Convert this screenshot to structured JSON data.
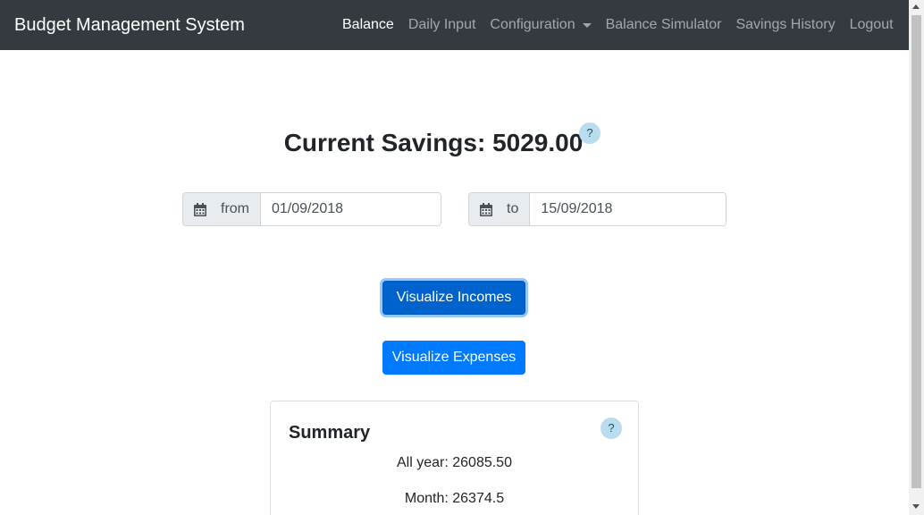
{
  "navbar": {
    "brand": "Budget Management System",
    "links": [
      {
        "label": "Balance",
        "active": true
      },
      {
        "label": "Daily Input",
        "active": false
      },
      {
        "label": "Configuration",
        "active": false
      },
      {
        "label": "Balance Simulator",
        "active": false
      },
      {
        "label": "Savings History",
        "active": false
      },
      {
        "label": "Logout",
        "active": false
      }
    ]
  },
  "savings": {
    "title": "Current Savings: 5029.00",
    "help": "?"
  },
  "date_range": {
    "from_label": "from",
    "from_value": "01/09/2018",
    "to_label": "to",
    "to_value": "15/09/2018",
    "icon": "calendar-icon"
  },
  "buttons": {
    "incomes": "Visualize Incomes",
    "expenses": "Visualize Expenses"
  },
  "summary": {
    "title": "Summary",
    "help": "?",
    "all_year": "All year: 26085.50",
    "month": "Month: 26374.5"
  },
  "colors": {
    "navbar_bg": "#343a40",
    "primary": "#007bff",
    "help_badge": "#b9dcef"
  }
}
